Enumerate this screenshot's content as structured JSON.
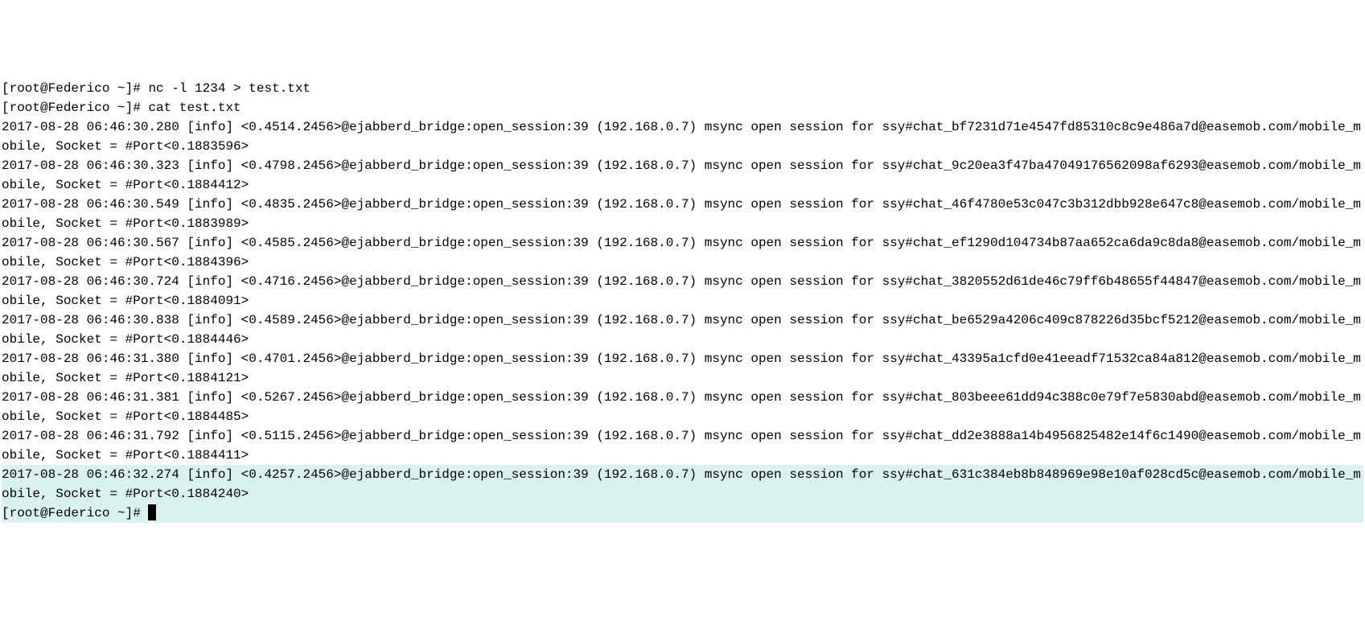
{
  "terminal": {
    "prompt": "[root@Federico ~]#",
    "cmd1": "nc -l 1234 > test.txt",
    "cmd2": "cat test.txt",
    "logs": [
      "2017-08-28 06:46:30.280 [info] <0.4514.2456>@ejabberd_bridge:open_session:39 (192.168.0.7) msync open session for ssy#chat_bf7231d71e4547fd85310c8c9e486a7d@easemob.com/mobile_mobile, Socket = #Port<0.1883596>",
      "2017-08-28 06:46:30.323 [info] <0.4798.2456>@ejabberd_bridge:open_session:39 (192.168.0.7) msync open session for ssy#chat_9c20ea3f47ba47049176562098af6293@easemob.com/mobile_mobile, Socket = #Port<0.1884412>",
      "2017-08-28 06:46:30.549 [info] <0.4835.2456>@ejabberd_bridge:open_session:39 (192.168.0.7) msync open session for ssy#chat_46f4780e53c047c3b312dbb928e647c8@easemob.com/mobile_mobile, Socket = #Port<0.1883989>",
      "2017-08-28 06:46:30.567 [info] <0.4585.2456>@ejabberd_bridge:open_session:39 (192.168.0.7) msync open session for ssy#chat_ef1290d104734b87aa652ca6da9c8da8@easemob.com/mobile_mobile, Socket = #Port<0.1884396>",
      "2017-08-28 06:46:30.724 [info] <0.4716.2456>@ejabberd_bridge:open_session:39 (192.168.0.7) msync open session for ssy#chat_3820552d61de46c79ff6b48655f44847@easemob.com/mobile_mobile, Socket = #Port<0.1884091>",
      "2017-08-28 06:46:30.838 [info] <0.4589.2456>@ejabberd_bridge:open_session:39 (192.168.0.7) msync open session for ssy#chat_be6529a4206c409c878226d35bcf5212@easemob.com/mobile_mobile, Socket = #Port<0.1884446>",
      "2017-08-28 06:46:31.380 [info] <0.4701.2456>@ejabberd_bridge:open_session:39 (192.168.0.7) msync open session for ssy#chat_43395a1cfd0e41eeadf71532ca84a812@easemob.com/mobile_mobile, Socket = #Port<0.1884121>",
      "2017-08-28 06:46:31.381 [info] <0.5267.2456>@ejabberd_bridge:open_session:39 (192.168.0.7) msync open session for ssy#chat_803beee61dd94c388c0e79f7e5830abd@easemob.com/mobile_mobile, Socket = #Port<0.1884485>",
      "2017-08-28 06:46:31.792 [info] <0.5115.2456>@ejabberd_bridge:open_session:39 (192.168.0.7) msync open session for ssy#chat_dd2e3888a14b4956825482e14f6c1490@easemob.com/mobile_mobile, Socket = #Port<0.1884411>",
      "2017-08-28 06:46:32.274 [info] <0.4257.2456>@ejabberd_bridge:open_session:39 (192.168.0.7) msync open session for ssy#chat_631c384eb8b848969e98e10af028cd5c@easemob.com/mobile_mobile, Socket = #Port<0.1884240>"
    ]
  }
}
